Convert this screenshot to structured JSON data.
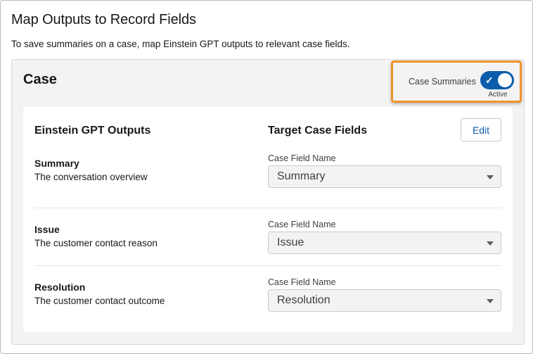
{
  "page": {
    "title": "Map Outputs to Record Fields",
    "description": "To save summaries on a case, map Einstein GPT outputs to relevant case fields."
  },
  "case_card": {
    "title": "Case",
    "toggle": {
      "label": "Case Summaries",
      "status": "Active",
      "checked": true,
      "check_glyph": "✓",
      "color": "#0b5cab"
    },
    "highlight_color": "#f0922b",
    "columns": {
      "outputs_header": "Einstein GPT Outputs",
      "target_header": "Target Case Fields"
    },
    "edit_label": "Edit",
    "rows": [
      {
        "name": "Summary",
        "description": "The conversation overview",
        "field_label": "Case Field Name",
        "field_value": "Summary"
      },
      {
        "name": "Issue",
        "description": "The customer contact reason",
        "field_label": "Case Field Name",
        "field_value": "Issue"
      },
      {
        "name": "Resolution",
        "description": "The customer contact outcome",
        "field_label": "Case Field Name",
        "field_value": "Resolution"
      }
    ]
  },
  "icons": {
    "toggle_check": "check-icon",
    "select_caret": "chevron-down-icon"
  }
}
